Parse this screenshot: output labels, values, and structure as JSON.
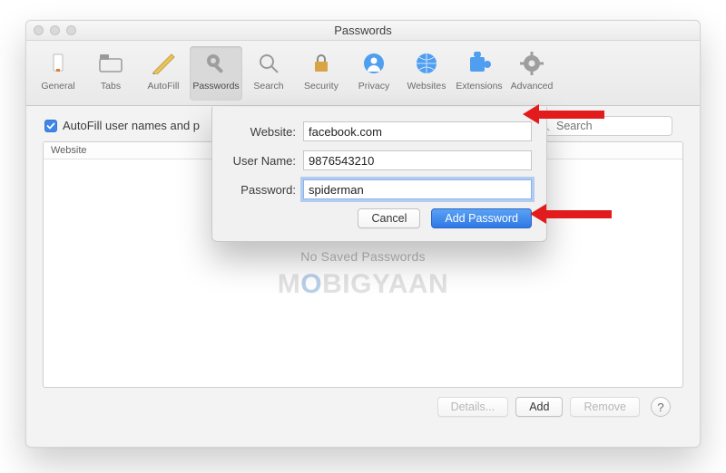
{
  "window": {
    "title": "Passwords"
  },
  "toolbar": {
    "items": [
      {
        "label": "General"
      },
      {
        "label": "Tabs"
      },
      {
        "label": "AutoFill"
      },
      {
        "label": "Passwords"
      },
      {
        "label": "Search"
      },
      {
        "label": "Security"
      },
      {
        "label": "Privacy"
      },
      {
        "label": "Websites"
      },
      {
        "label": "Extensions"
      },
      {
        "label": "Advanced"
      }
    ]
  },
  "autofill": {
    "checkbox_label": "AutoFill user names and p"
  },
  "search": {
    "placeholder": "Search"
  },
  "table": {
    "column_header": "Website",
    "empty_text": "No Saved Passwords"
  },
  "watermark": {
    "pre": "M",
    "mid": "O",
    "post": "BIGYAAN"
  },
  "footer": {
    "details_label": "Details...",
    "add_label": "Add",
    "remove_label": "Remove",
    "help_label": "?"
  },
  "sheet": {
    "website_label": "Website:",
    "username_label": "User Name:",
    "password_label": "Password:",
    "website_value": "facebook.com",
    "username_value": "9876543210",
    "password_value": "spiderman",
    "cancel_label": "Cancel",
    "add_password_label": "Add Password"
  }
}
